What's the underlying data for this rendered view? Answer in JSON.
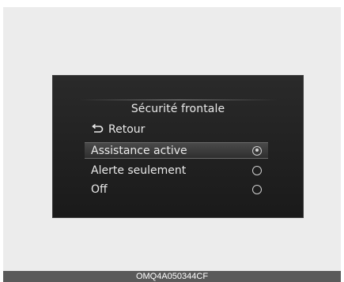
{
  "screen": {
    "title": "Sécurité frontale",
    "back_label": "Retour",
    "options": [
      {
        "label": "Assistance active",
        "selected": true
      },
      {
        "label": "Alerte seulement",
        "selected": false
      },
      {
        "label": "Off",
        "selected": false
      }
    ]
  },
  "caption": "OMQ4A050344CF",
  "icons": {
    "back": "back-arrow-icon",
    "radio": "radio-button-icon"
  },
  "colors": {
    "screen_bg": "#1f1f1f",
    "text": "#eaeaea",
    "caption_bg": "#5a5a5a"
  }
}
